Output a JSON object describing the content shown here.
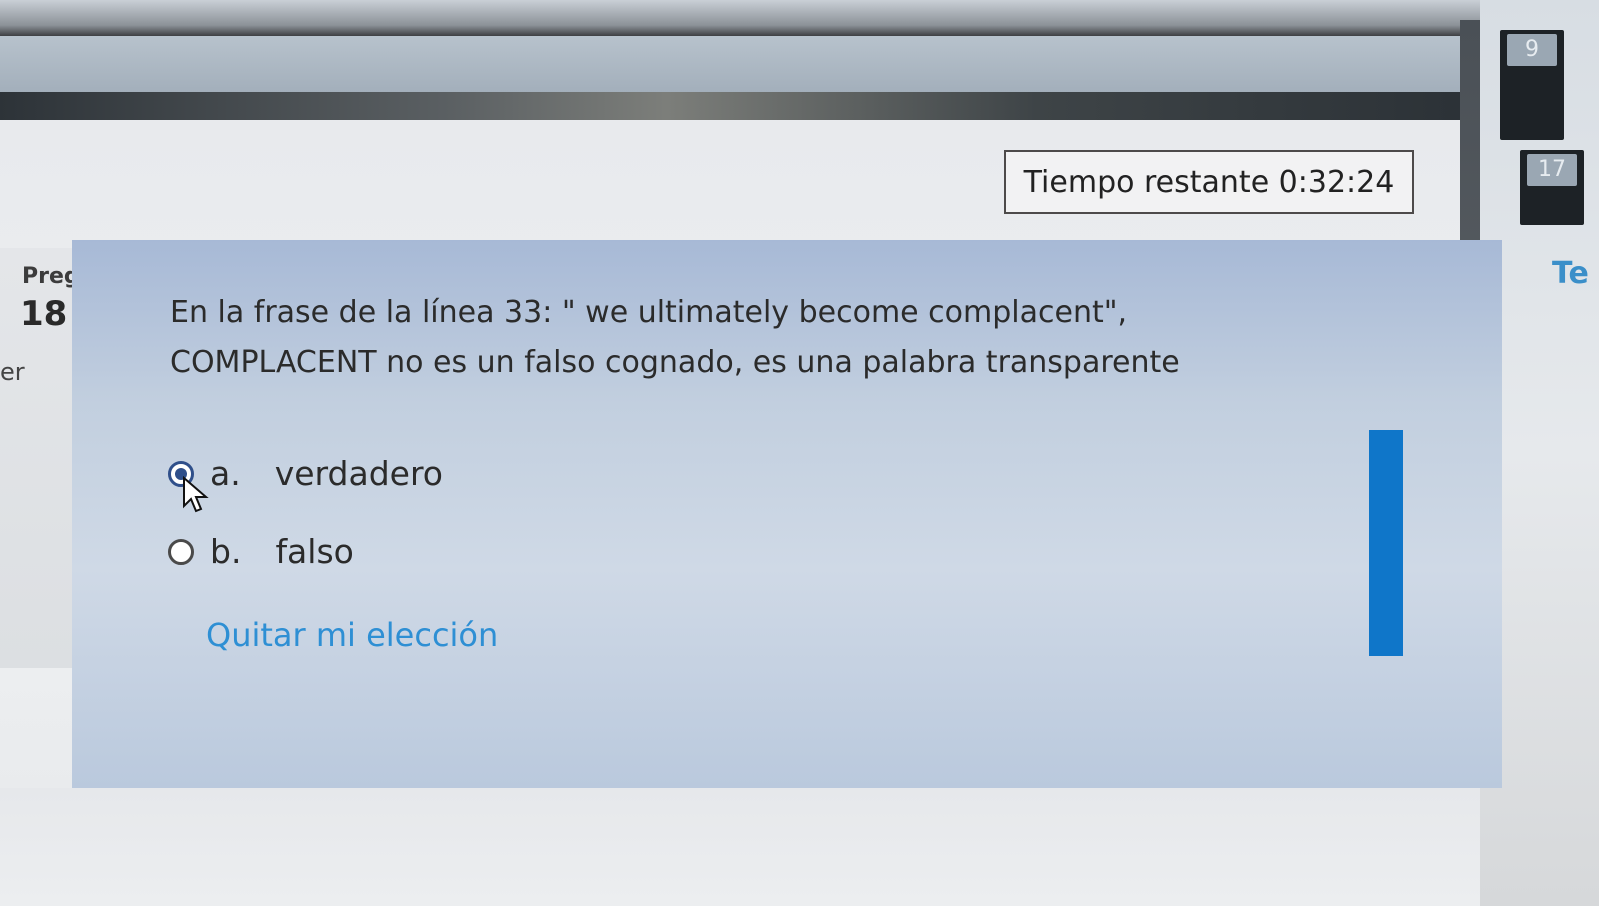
{
  "timer": {
    "label": "Tiempo restante 0:32:24"
  },
  "question_info": {
    "label": "Pregun",
    "number": "18",
    "extra": "er"
  },
  "question": {
    "line1": "En la frase de la línea 33: \" we ultimately become complacent\",",
    "line2": "COMPLACENT no es un falso cognado, es una palabra transparente"
  },
  "answers": [
    {
      "letter": "a.",
      "text": "verdadero",
      "selected": true
    },
    {
      "letter": "b.",
      "text": "falso",
      "selected": false
    }
  ],
  "clear_choice": "Quitar mi elección",
  "nav": {
    "items": [
      "9",
      "17"
    ],
    "partial_text": "Te"
  },
  "colors": {
    "link": "#2e8fd4",
    "accent_bar": "#0f76c9",
    "card_bg": "#c2cfdf"
  }
}
